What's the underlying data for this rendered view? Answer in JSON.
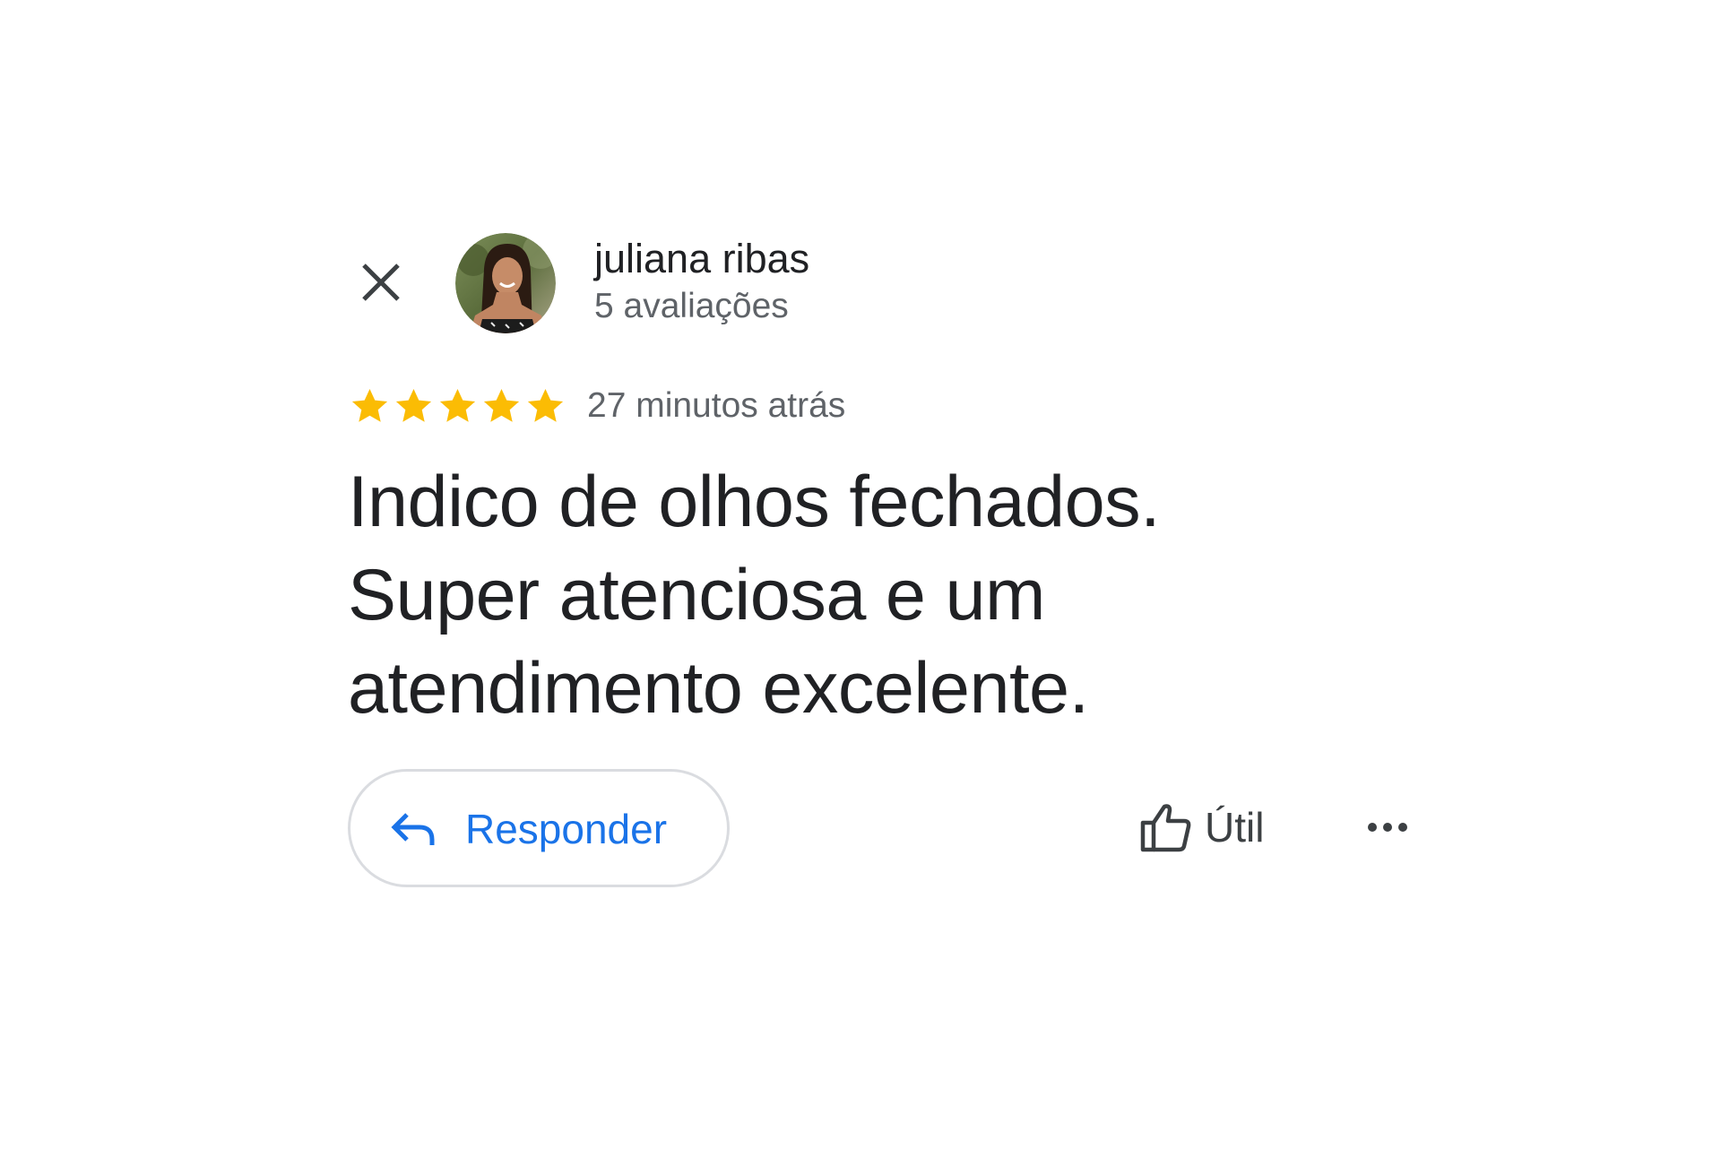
{
  "header": {
    "close_icon": "close-icon",
    "avatar_icon": "user-avatar",
    "user_name": "juliana ribas",
    "user_reviews": "5 avaliações"
  },
  "rating": {
    "stars": 5,
    "max_stars": 5,
    "star_color": "#fbbc04",
    "time_ago": "27 minutos atrás"
  },
  "review": {
    "lines": [
      "Indico de olhos fechados.",
      "Super atenciosa e um",
      "atendimento excelente."
    ]
  },
  "actions": {
    "reply_icon": "reply-arrow-icon",
    "reply_label": "Responder",
    "helpful_icon": "thumbs-up-icon",
    "helpful_label": "Útil",
    "more_icon": "more-horizontal-icon",
    "accent_color": "#1a73e8"
  }
}
